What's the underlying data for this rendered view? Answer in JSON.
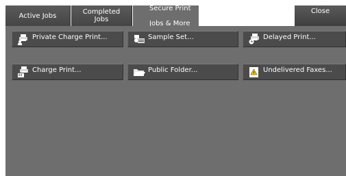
{
  "tabs": {
    "active_jobs": "Active Jobs",
    "completed_jobs": [
      "Completed",
      "Jobs"
    ],
    "secure_print": [
      "Secure Print",
      "Jobs & More"
    ]
  },
  "close_label": "Close",
  "buttons": {
    "private_charge_print": "Private Charge Print...",
    "sample_set": "Sample Set...",
    "delayed_print": "Delayed Print...",
    "charge_print": "Charge Print...",
    "public_folder": "Public Folder...",
    "undelivered_faxes": "Undelivered Faxes..."
  },
  "icons": {
    "private_charge_print": "printer-user-icon",
    "sample_set": "sample-set-icon",
    "delayed_print": "printer-clock-icon",
    "charge_print": "printer-keypad-icon",
    "public_folder": "folder-icon",
    "undelivered_faxes": "fax-warning-icon"
  },
  "colors": {
    "panel": "#6e6e6e",
    "button": "#4b4b4b",
    "tab": "#4f4f4f",
    "active_tab": "#6e6e6e",
    "warning": "#f2c200"
  }
}
